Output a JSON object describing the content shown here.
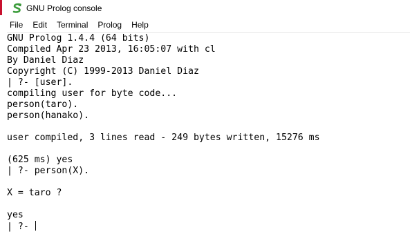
{
  "window": {
    "title": "GNU Prolog console",
    "icon": "gnu-prolog-s-icon"
  },
  "menu": [
    "File",
    "Edit",
    "Terminal",
    "Prolog",
    "Help"
  ],
  "console": {
    "lines": [
      "GNU Prolog 1.4.4 (64 bits)",
      "Compiled Apr 23 2013, 16:05:07 with cl",
      "By Daniel Diaz",
      "Copyright (C) 1999-2013 Daniel Diaz",
      "| ?- [user].",
      "compiling user for byte code...",
      "person(taro).",
      "person(hanako).",
      "",
      "user compiled, 3 lines read - 249 bytes written, 15276 ms",
      "",
      "(625 ms) yes",
      "| ?- person(X).",
      "",
      "X = taro ?",
      "",
      "yes"
    ],
    "prompt": "| ?- "
  },
  "colors": {
    "icon_green": "#3a9c3a",
    "side_strip_red": "#c8102e"
  }
}
